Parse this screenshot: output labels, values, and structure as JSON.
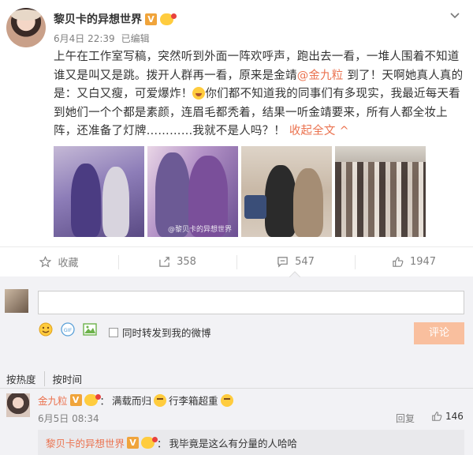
{
  "post": {
    "username": "黎贝卡的异想世界",
    "verified_badge": "V",
    "date": "6月4日 22:39",
    "edited": "已编辑",
    "text_line1": "上午在工作室写稿，突然听到外面一阵欢呼声，跑出去一看，一堆人围着不知道",
    "text_line2": "谁又是叫又是跳。拨开人群再一看，原来是金靖",
    "mention": "@金九粒",
    "text_line2b": " 到了！天啊她真人真的",
    "text_line3a": "是：又白又瘦，可爱爆炸！",
    "text_line3b": "你们都不知道我的同事们有多现实，我最近每天看",
    "text_line4": "到她们一个个都是素颜，连眉毛都秃着，结果一听金靖要来，所有人都全妆上",
    "text_line5": "阵，还准备了灯牌…………我就不是人吗？！",
    "collapse_label": "收起全文",
    "collapse_arrow": "^",
    "photo_watermark": "@黎贝卡的异想世界"
  },
  "actions": {
    "favorite_label": "收藏",
    "repost_count": "358",
    "comment_count": "547",
    "like_count": "1947"
  },
  "comment_box": {
    "forward_label": "同时转发到我的微博",
    "submit_label": "评论"
  },
  "sort": {
    "by_hot": "按热度",
    "by_time": "按时间"
  },
  "comment": {
    "name": "金九粒",
    "badge": "V",
    "colon": "：",
    "text1": "满载而归",
    "text2": "行李箱超重",
    "date": "6月5日 08:34",
    "reply_label": "回复",
    "like_count": "146"
  },
  "sub_reply": {
    "name": "黎贝卡的异想世界",
    "badge": "V",
    "colon": "：",
    "text": "我毕竟是这么有分量的人哈哈"
  },
  "colors": {
    "accent": "#eb7350",
    "muted": "#808080",
    "submit_bg": "#f9bf9e"
  }
}
